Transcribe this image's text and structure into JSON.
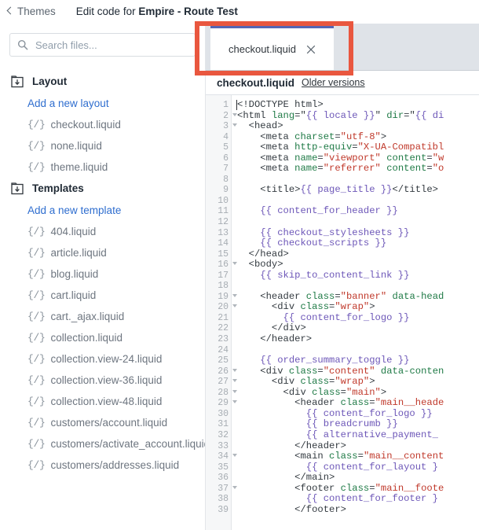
{
  "topbar": {
    "back_label": "Themes",
    "back_icon": "chevron-left-icon",
    "title_prefix": "Edit code for ",
    "title_theme": "Empire - Route Test"
  },
  "sidebar": {
    "search": {
      "placeholder": "Search files...",
      "value": "",
      "icon": "search-icon"
    },
    "groups": [
      {
        "name": "Layout",
        "icon": "folder-down-icon",
        "add_label": "Add a new layout",
        "files": [
          {
            "prefix": "{/}",
            "name": "checkout.liquid"
          },
          {
            "prefix": "{/}",
            "name": "none.liquid"
          },
          {
            "prefix": "{/}",
            "name": "theme.liquid"
          }
        ]
      },
      {
        "name": "Templates",
        "icon": "folder-down-icon",
        "add_label": "Add a new template",
        "files": [
          {
            "prefix": "{/}",
            "name": "404.liquid"
          },
          {
            "prefix": "{/}",
            "name": "article.liquid"
          },
          {
            "prefix": "{/}",
            "name": "blog.liquid"
          },
          {
            "prefix": "{/}",
            "name": "cart.liquid"
          },
          {
            "prefix": "{/}",
            "name": "cart._ajax.liquid"
          },
          {
            "prefix": "{/}",
            "name": "collection.liquid"
          },
          {
            "prefix": "{/}",
            "name": "collection.view-24.liquid"
          },
          {
            "prefix": "{/}",
            "name": "collection.view-36.liquid"
          },
          {
            "prefix": "{/}",
            "name": "collection.view-48.liquid"
          },
          {
            "prefix": "{/}",
            "name": "customers/account.liquid"
          },
          {
            "prefix": "{/}",
            "name": "customers/activate_account.liquid"
          },
          {
            "prefix": "{/}",
            "name": "customers/addresses.liquid"
          }
        ]
      }
    ]
  },
  "editor_panel": {
    "tabs": [
      {
        "label": "checkout.liquid",
        "close_icon": "close-icon",
        "active": true
      }
    ],
    "file_header": {
      "filename": "checkout.liquid",
      "older_versions_label": "Older versions"
    },
    "accent_color": "#5566b5",
    "annotation_color": "#e9573f"
  },
  "code": {
    "first_line": 1,
    "lines": [
      {
        "n": 1,
        "fold": false,
        "tokens": [
          {
            "t": "tag",
            "v": "<!DOCTYPE html>"
          }
        ]
      },
      {
        "n": 2,
        "fold": true,
        "tokens": [
          {
            "t": "tag",
            "v": "<html "
          },
          {
            "t": "attr",
            "v": "lang"
          },
          {
            "t": "tag",
            "v": "=\""
          },
          {
            "t": "liq",
            "v": "{{ locale }}"
          },
          {
            "t": "tag",
            "v": "\" "
          },
          {
            "t": "attr",
            "v": "dir"
          },
          {
            "t": "tag",
            "v": "=\""
          },
          {
            "t": "liq",
            "v": "{{ di"
          }
        ]
      },
      {
        "n": 3,
        "fold": true,
        "tokens": [
          {
            "t": "tag",
            "v": "  <head>"
          }
        ]
      },
      {
        "n": 4,
        "fold": false,
        "tokens": [
          {
            "t": "tag",
            "v": "    <meta "
          },
          {
            "t": "attr",
            "v": "charset"
          },
          {
            "t": "tag",
            "v": "="
          },
          {
            "t": "str",
            "v": "\"utf-8\""
          },
          {
            "t": "tag",
            "v": ">"
          }
        ]
      },
      {
        "n": 5,
        "fold": false,
        "tokens": [
          {
            "t": "tag",
            "v": "    <meta "
          },
          {
            "t": "attr",
            "v": "http-equiv"
          },
          {
            "t": "tag",
            "v": "="
          },
          {
            "t": "str",
            "v": "\"X-UA-Compatibl"
          }
        ]
      },
      {
        "n": 6,
        "fold": false,
        "tokens": [
          {
            "t": "tag",
            "v": "    <meta "
          },
          {
            "t": "attr",
            "v": "name"
          },
          {
            "t": "tag",
            "v": "="
          },
          {
            "t": "str",
            "v": "\"viewport\""
          },
          {
            "t": "tag",
            "v": " "
          },
          {
            "t": "attr",
            "v": "content"
          },
          {
            "t": "tag",
            "v": "="
          },
          {
            "t": "str",
            "v": "\"w"
          }
        ]
      },
      {
        "n": 7,
        "fold": false,
        "tokens": [
          {
            "t": "tag",
            "v": "    <meta "
          },
          {
            "t": "attr",
            "v": "name"
          },
          {
            "t": "tag",
            "v": "="
          },
          {
            "t": "str",
            "v": "\"referrer\""
          },
          {
            "t": "tag",
            "v": " "
          },
          {
            "t": "attr",
            "v": "content"
          },
          {
            "t": "tag",
            "v": "="
          },
          {
            "t": "str",
            "v": "\"o"
          }
        ]
      },
      {
        "n": 8,
        "fold": false,
        "tokens": []
      },
      {
        "n": 9,
        "fold": false,
        "tokens": [
          {
            "t": "tag",
            "v": "    <title>"
          },
          {
            "t": "liq",
            "v": "{{ page_title }}"
          },
          {
            "t": "tag",
            "v": "</title>"
          }
        ]
      },
      {
        "n": 10,
        "fold": false,
        "tokens": []
      },
      {
        "n": 11,
        "fold": false,
        "tokens": [
          {
            "t": "tag",
            "v": "    "
          },
          {
            "t": "liq",
            "v": "{{ content_for_header }}"
          }
        ]
      },
      {
        "n": 12,
        "fold": false,
        "tokens": []
      },
      {
        "n": 13,
        "fold": false,
        "tokens": [
          {
            "t": "tag",
            "v": "    "
          },
          {
            "t": "liq",
            "v": "{{ checkout_stylesheets }}"
          }
        ]
      },
      {
        "n": 14,
        "fold": false,
        "tokens": [
          {
            "t": "tag",
            "v": "    "
          },
          {
            "t": "liq",
            "v": "{{ checkout_scripts }}"
          }
        ]
      },
      {
        "n": 15,
        "fold": false,
        "tokens": [
          {
            "t": "tag",
            "v": "  </head>"
          }
        ]
      },
      {
        "n": 16,
        "fold": true,
        "tokens": [
          {
            "t": "tag",
            "v": "  <body>"
          }
        ]
      },
      {
        "n": 17,
        "fold": false,
        "tokens": [
          {
            "t": "tag",
            "v": "    "
          },
          {
            "t": "liq",
            "v": "{{ skip_to_content_link }}"
          }
        ]
      },
      {
        "n": 18,
        "fold": false,
        "tokens": []
      },
      {
        "n": 19,
        "fold": true,
        "tokens": [
          {
            "t": "tag",
            "v": "    <header "
          },
          {
            "t": "attr",
            "v": "class"
          },
          {
            "t": "tag",
            "v": "="
          },
          {
            "t": "str",
            "v": "\"banner\""
          },
          {
            "t": "tag",
            "v": " "
          },
          {
            "t": "attr",
            "v": "data-head"
          }
        ]
      },
      {
        "n": 20,
        "fold": true,
        "tokens": [
          {
            "t": "tag",
            "v": "      <div "
          },
          {
            "t": "attr",
            "v": "class"
          },
          {
            "t": "tag",
            "v": "="
          },
          {
            "t": "str",
            "v": "\"wrap\""
          },
          {
            "t": "tag",
            "v": ">"
          }
        ]
      },
      {
        "n": 21,
        "fold": false,
        "tokens": [
          {
            "t": "tag",
            "v": "        "
          },
          {
            "t": "liq",
            "v": "{{ content_for_logo }}"
          }
        ]
      },
      {
        "n": 22,
        "fold": false,
        "tokens": [
          {
            "t": "tag",
            "v": "      </div>"
          }
        ]
      },
      {
        "n": 23,
        "fold": false,
        "tokens": [
          {
            "t": "tag",
            "v": "    </header>"
          }
        ]
      },
      {
        "n": 24,
        "fold": false,
        "tokens": []
      },
      {
        "n": 25,
        "fold": false,
        "tokens": [
          {
            "t": "tag",
            "v": "    "
          },
          {
            "t": "liq",
            "v": "{{ order_summary_toggle }}"
          }
        ]
      },
      {
        "n": 26,
        "fold": true,
        "tokens": [
          {
            "t": "tag",
            "v": "    <div "
          },
          {
            "t": "attr",
            "v": "class"
          },
          {
            "t": "tag",
            "v": "="
          },
          {
            "t": "str",
            "v": "\"content\""
          },
          {
            "t": "tag",
            "v": " "
          },
          {
            "t": "attr",
            "v": "data-conten"
          }
        ]
      },
      {
        "n": 27,
        "fold": true,
        "tokens": [
          {
            "t": "tag",
            "v": "      <div "
          },
          {
            "t": "attr",
            "v": "class"
          },
          {
            "t": "tag",
            "v": "="
          },
          {
            "t": "str",
            "v": "\"wrap\""
          },
          {
            "t": "tag",
            "v": ">"
          }
        ]
      },
      {
        "n": 28,
        "fold": true,
        "tokens": [
          {
            "t": "tag",
            "v": "        <div "
          },
          {
            "t": "attr",
            "v": "class"
          },
          {
            "t": "tag",
            "v": "="
          },
          {
            "t": "str",
            "v": "\"main\""
          },
          {
            "t": "tag",
            "v": ">"
          }
        ]
      },
      {
        "n": 29,
        "fold": true,
        "tokens": [
          {
            "t": "tag",
            "v": "          <header "
          },
          {
            "t": "attr",
            "v": "class"
          },
          {
            "t": "tag",
            "v": "="
          },
          {
            "t": "str",
            "v": "\"main__heade"
          }
        ]
      },
      {
        "n": 30,
        "fold": false,
        "tokens": [
          {
            "t": "tag",
            "v": "            "
          },
          {
            "t": "liq",
            "v": "{{ content_for_logo }}"
          }
        ]
      },
      {
        "n": 31,
        "fold": false,
        "tokens": [
          {
            "t": "tag",
            "v": "            "
          },
          {
            "t": "liq",
            "v": "{{ breadcrumb }}"
          }
        ]
      },
      {
        "n": 32,
        "fold": false,
        "tokens": [
          {
            "t": "tag",
            "v": "            "
          },
          {
            "t": "liq",
            "v": "{{ alternative_payment_"
          }
        ]
      },
      {
        "n": 33,
        "fold": false,
        "tokens": [
          {
            "t": "tag",
            "v": "          </header>"
          }
        ]
      },
      {
        "n": 34,
        "fold": true,
        "tokens": [
          {
            "t": "tag",
            "v": "          <main "
          },
          {
            "t": "attr",
            "v": "class"
          },
          {
            "t": "tag",
            "v": "="
          },
          {
            "t": "str",
            "v": "\"main__content"
          }
        ]
      },
      {
        "n": 35,
        "fold": false,
        "tokens": [
          {
            "t": "tag",
            "v": "            "
          },
          {
            "t": "liq",
            "v": "{{ content_for_layout }"
          }
        ]
      },
      {
        "n": 36,
        "fold": false,
        "tokens": [
          {
            "t": "tag",
            "v": "          </main>"
          }
        ]
      },
      {
        "n": 37,
        "fold": true,
        "tokens": [
          {
            "t": "tag",
            "v": "          <footer "
          },
          {
            "t": "attr",
            "v": "class"
          },
          {
            "t": "tag",
            "v": "="
          },
          {
            "t": "str",
            "v": "\"main__foote"
          }
        ]
      },
      {
        "n": 38,
        "fold": false,
        "tokens": [
          {
            "t": "tag",
            "v": "            "
          },
          {
            "t": "liq",
            "v": "{{ content_for_footer }"
          }
        ]
      },
      {
        "n": 39,
        "fold": false,
        "tokens": [
          {
            "t": "tag",
            "v": "          </footer>"
          }
        ]
      }
    ]
  }
}
